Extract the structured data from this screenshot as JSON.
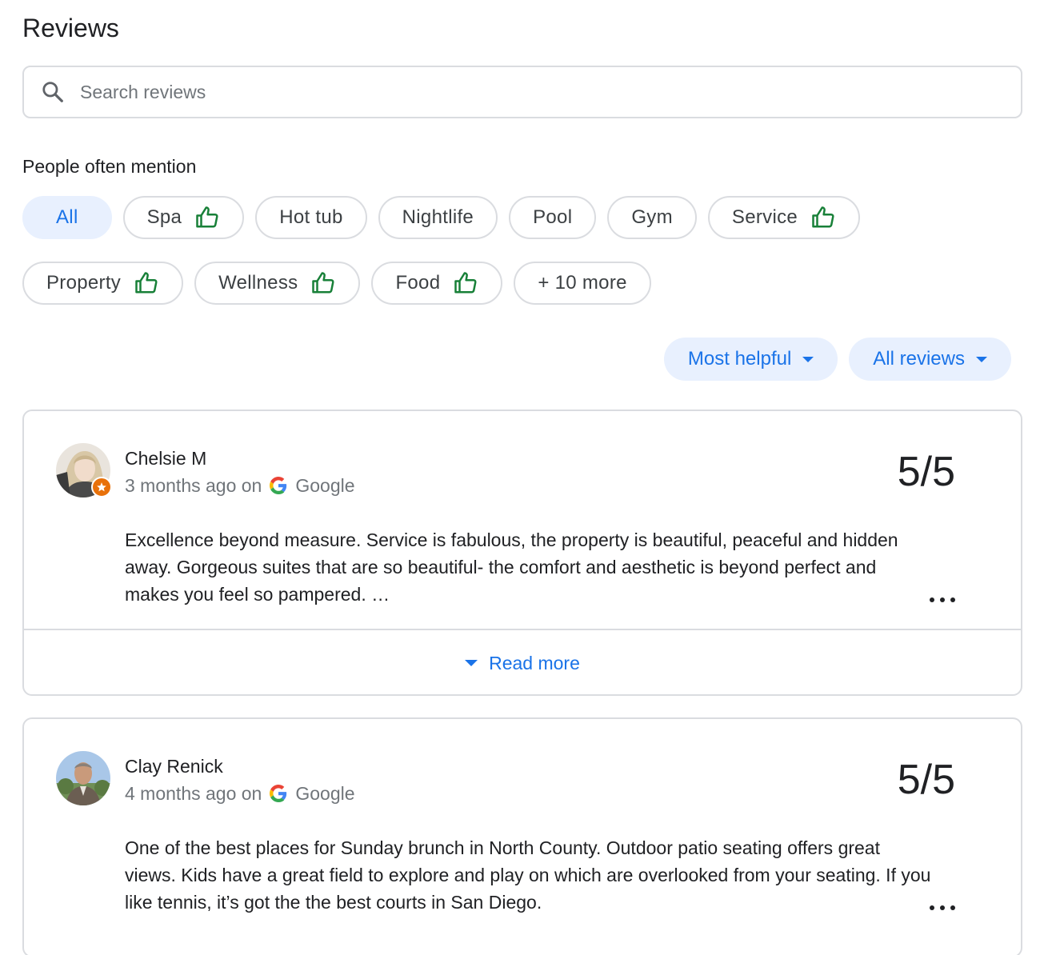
{
  "header": {
    "title": "Reviews"
  },
  "search": {
    "placeholder": "Search reviews",
    "value": ""
  },
  "mentions": {
    "label": "People often mention",
    "chips": [
      {
        "label": "All",
        "active": true,
        "thumbs_up": false
      },
      {
        "label": "Spa",
        "thumbs_up": true
      },
      {
        "label": "Hot tub",
        "thumbs_up": false
      },
      {
        "label": "Nightlife",
        "thumbs_up": false
      },
      {
        "label": "Pool",
        "thumbs_up": false
      },
      {
        "label": "Gym",
        "thumbs_up": false
      },
      {
        "label": "Service",
        "thumbs_up": true
      },
      {
        "label": "Property",
        "thumbs_up": true
      },
      {
        "label": "Wellness",
        "thumbs_up": true
      },
      {
        "label": "Food",
        "thumbs_up": true
      },
      {
        "label": "+ 10 more",
        "thumbs_up": false
      }
    ]
  },
  "sort": {
    "order_label": "Most helpful",
    "filter_label": "All reviews"
  },
  "reviews": [
    {
      "name": "Chelsie M",
      "time": "3 months ago on",
      "source": "Google",
      "rating": "5/5",
      "text": "Excellence beyond measure. Service is fabulous, the property is beautiful, peaceful and hidden away. Gorgeous suites that are so beautiful- the comfort and aesthetic is beyond perfect and makes you feel so pampered. …",
      "read_more": "Read more"
    },
    {
      "name": "Clay Renick",
      "time": "4 months ago on",
      "source": "Google",
      "rating": "5/5",
      "text": "One of the best places for Sunday brunch in North County. Outdoor patio seating offers great views. Kids have a great field to explore and play on which are overlooked from your seating. If you like tennis, it’s got the the best courts in San Diego."
    }
  ],
  "colors": {
    "accent": "#1a73e8",
    "chip_active_bg": "#e8f0fe",
    "thumbs_up_green": "#188038",
    "local_guide_badge": "#e8710a",
    "border": "#dadce0"
  },
  "icons": {
    "search": "search-icon",
    "thumbs_up": "thumbs-up-icon",
    "dropdown": "caret-down-icon",
    "google": "google-g-icon",
    "more": "more-horizontal-icon",
    "local_guide": "local-guide-badge-icon"
  }
}
